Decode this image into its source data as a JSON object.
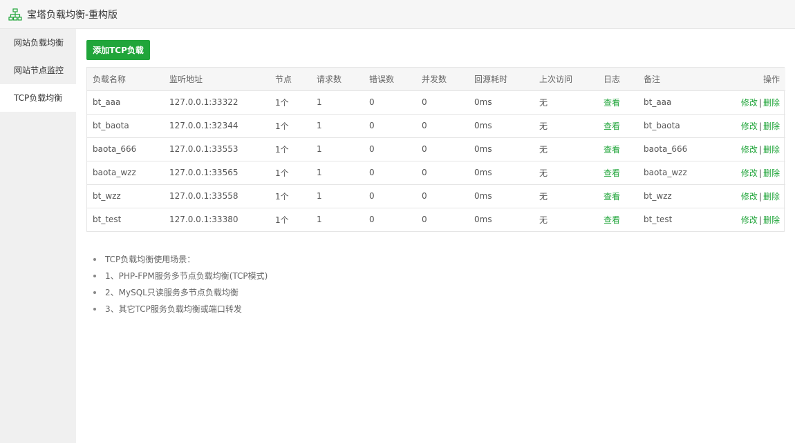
{
  "app": {
    "title": "宝塔负载均衡-重构版",
    "accent_color": "#20a53a"
  },
  "sidebar": {
    "items": [
      {
        "label": "网站负载均衡",
        "active": false
      },
      {
        "label": "网站节点监控",
        "active": false
      },
      {
        "label": "TCP负载均衡",
        "active": true
      }
    ]
  },
  "toolbar": {
    "add_label": "添加TCP负载"
  },
  "table": {
    "headers": {
      "name": "负载名称",
      "addr": "监听地址",
      "nodes": "节点",
      "requests": "请求数",
      "errors": "错误数",
      "concurrent": "并发数",
      "latency": "回源耗时",
      "last": "上次访问",
      "log": "日志",
      "note": "备注",
      "ops": "操作"
    },
    "log_label": "查看",
    "edit_label": "修改",
    "op_sep": "|",
    "delete_label": "删除",
    "rows": [
      {
        "name": "bt_aaa",
        "addr": "127.0.0.1:33322",
        "nodes": "1个",
        "requests": "1",
        "errors": "0",
        "concurrent": "0",
        "latency": "0ms",
        "last": "无",
        "note": "bt_aaa"
      },
      {
        "name": "bt_baota",
        "addr": "127.0.0.1:32344",
        "nodes": "1个",
        "requests": "1",
        "errors": "0",
        "concurrent": "0",
        "latency": "0ms",
        "last": "无",
        "note": "bt_baota"
      },
      {
        "name": "baota_666",
        "addr": "127.0.0.1:33553",
        "nodes": "1个",
        "requests": "1",
        "errors": "0",
        "concurrent": "0",
        "latency": "0ms",
        "last": "无",
        "note": "baota_666"
      },
      {
        "name": "baota_wzz",
        "addr": "127.0.0.1:33565",
        "nodes": "1个",
        "requests": "1",
        "errors": "0",
        "concurrent": "0",
        "latency": "0ms",
        "last": "无",
        "note": "baota_wzz"
      },
      {
        "name": "bt_wzz",
        "addr": "127.0.0.1:33558",
        "nodes": "1个",
        "requests": "1",
        "errors": "0",
        "concurrent": "0",
        "latency": "0ms",
        "last": "无",
        "note": "bt_wzz"
      },
      {
        "name": "bt_test",
        "addr": "127.0.0.1:33380",
        "nodes": "1个",
        "requests": "1",
        "errors": "0",
        "concurrent": "0",
        "latency": "0ms",
        "last": "无",
        "note": "bt_test"
      }
    ]
  },
  "notes": [
    "TCP负载均衡使用场景：",
    "1、PHP-FPM服务多节点负载均衡(TCP模式)",
    "2、MySQL只读服务多节点负载均衡",
    "3、其它TCP服务负载均衡或端口转发"
  ]
}
